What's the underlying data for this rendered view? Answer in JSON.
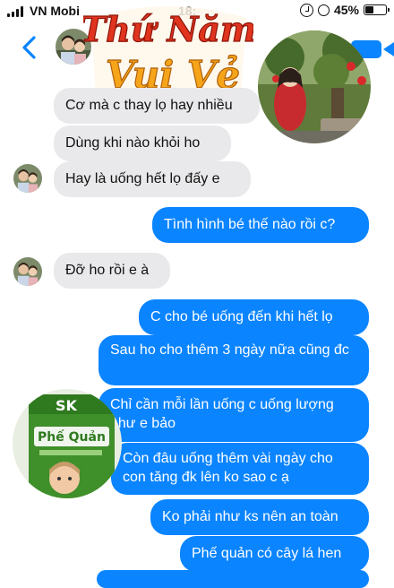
{
  "status_bar": {
    "carrier": "VN Mobi",
    "time": "18:",
    "battery": "45%",
    "battery_level": 0.45
  },
  "header": {
    "back_icon": "chevron-left-icon",
    "video_icon": "video-call-icon"
  },
  "sticker": {
    "title_line1": "Thứ Năm",
    "title_line2": "Vui Vẻ",
    "book_brand": "SK",
    "book_title": "Phế Quản"
  },
  "colors": {
    "outgoing_bubble": "#0a84ff",
    "incoming_bubble": "#e9e9eb",
    "accent": "#0a84ff"
  },
  "messages": [
    {
      "direction": "incoming",
      "text": "Cơ mà c thay lọ hay nhiều"
    },
    {
      "direction": "incoming",
      "text": "Dùng khi nào khỏi ho"
    },
    {
      "direction": "incoming",
      "text": "Hay là uống hết lọ đấy e"
    },
    {
      "direction": "outgoing",
      "text": "Tình hình bé thế nào rồi c?"
    },
    {
      "direction": "incoming",
      "text": "Đỡ ho rồi e à"
    },
    {
      "direction": "outgoing",
      "text": "C cho bé uống đến khi hết lọ"
    },
    {
      "direction": "outgoing",
      "text": "Sau ho cho thêm 3 ngày nữa cũng đc"
    },
    {
      "direction": "outgoing",
      "text": "Chỉ cần mỗi lần uống c uống lượng như e bảo"
    },
    {
      "direction": "outgoing",
      "text": "Còn đâu uống thêm vài ngày cho con tăng đk lên ko sao c ạ"
    },
    {
      "direction": "outgoing",
      "text": "Ko phải như ks nên an toàn"
    },
    {
      "direction": "outgoing",
      "text": "Phế quản có cây lá hen"
    }
  ]
}
